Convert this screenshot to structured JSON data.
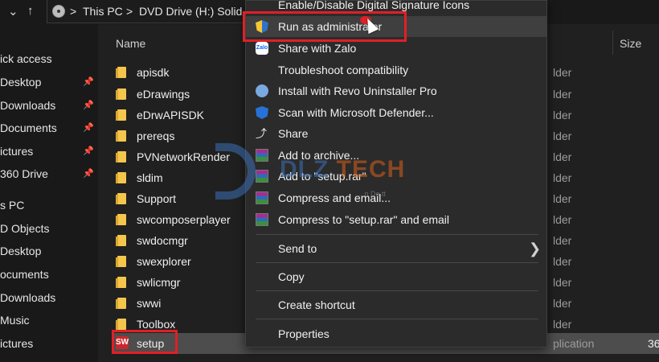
{
  "address": {
    "crumbs": [
      "This PC",
      "DVD Drive (H:) Solid"
    ],
    "sep": ">"
  },
  "nav": {
    "back": "↑",
    "expand": "⌄"
  },
  "sidebar": {
    "items": [
      {
        "label": "ick access",
        "pinned": false
      },
      {
        "label": "Desktop",
        "pinned": true
      },
      {
        "label": "Downloads",
        "pinned": true
      },
      {
        "label": "Documents",
        "pinned": true
      },
      {
        "label": "ictures",
        "pinned": true
      },
      {
        "label": "360 Drive",
        "pinned": true
      },
      {
        "label": "s PC",
        "pinned": false
      },
      {
        "label": "D Objects",
        "pinned": false
      },
      {
        "label": "Desktop",
        "pinned": false
      },
      {
        "label": "ocuments",
        "pinned": false
      },
      {
        "label": "Downloads",
        "pinned": false
      },
      {
        "label": "Music",
        "pinned": false
      },
      {
        "label": "ictures",
        "pinned": false
      }
    ],
    "pin_glyph": "📌"
  },
  "columns": {
    "name": "Name",
    "size": "Size"
  },
  "files": [
    {
      "name": "apisdk",
      "type": "lder"
    },
    {
      "name": "eDrawings",
      "type": "lder"
    },
    {
      "name": "eDrwAPISDK",
      "type": "lder"
    },
    {
      "name": "prereqs",
      "type": "lder"
    },
    {
      "name": "PVNetworkRender",
      "type": "lder"
    },
    {
      "name": "sldim",
      "type": "lder"
    },
    {
      "name": "Support",
      "type": "lder"
    },
    {
      "name": "swcomposerplayer",
      "type": "lder"
    },
    {
      "name": "swdocmgr",
      "type": "lder"
    },
    {
      "name": "swexplorer",
      "type": "lder"
    },
    {
      "name": "swlicmgr",
      "type": "lder"
    },
    {
      "name": "swwi",
      "type": "lder"
    },
    {
      "name": "Toolbox",
      "type": "lder"
    },
    {
      "name": "setup",
      "type": "plication",
      "size": "36"
    }
  ],
  "menu": {
    "items": [
      {
        "label": "Enable/Disable Digital Signature Icons",
        "icon": "none"
      },
      {
        "label": "Run as administrator",
        "icon": "uac-shield-icon"
      },
      {
        "label": "Share with Zalo",
        "icon": "zalo-icon"
      },
      {
        "label": "Troubleshoot compatibility",
        "icon": "none"
      },
      {
        "label": "Install with Revo Uninstaller Pro",
        "icon": "revo-icon"
      },
      {
        "label": "Scan with Microsoft Defender...",
        "icon": "defender-shield-icon"
      },
      {
        "label": "Share",
        "icon": "share-icon"
      },
      {
        "label": "Add to archive...",
        "icon": "winrar-icon"
      },
      {
        "label": "Add to \"setup.rar\"",
        "icon": "winrar-icon"
      },
      {
        "label": "Compress and email...",
        "icon": "winrar-icon"
      },
      {
        "label": "Compress to \"setup.rar\" and email",
        "icon": "winrar-icon"
      },
      {
        "label": "Send to",
        "icon": "none"
      },
      {
        "label": "Copy",
        "icon": "none"
      },
      {
        "label": "Create shortcut",
        "icon": "none"
      },
      {
        "label": "Properties",
        "icon": "none"
      }
    ],
    "submenu_chevron": "❯",
    "zalo_text": "Zalo",
    "share_glyph": "⤴"
  },
  "sw_icon_text": "SW",
  "watermark": {
    "brand_a": "DLZ",
    "brand_b": "TECH",
    "sub": "...n Do.tt"
  },
  "colors": {
    "highlight_box": "#e01f26",
    "folder": "#f4c64d",
    "menu_bg": "#2b2b2b"
  }
}
